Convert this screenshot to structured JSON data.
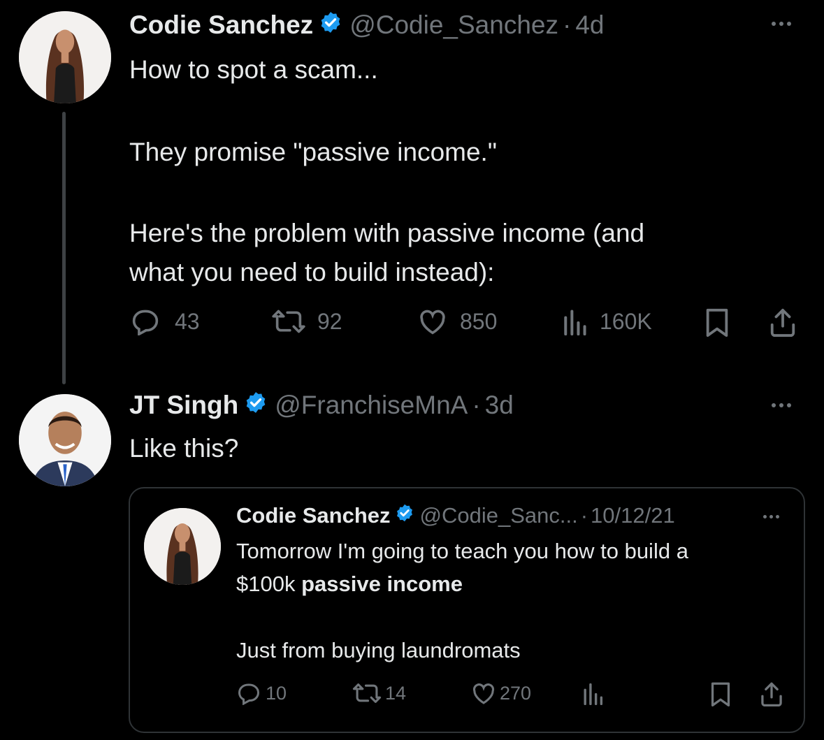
{
  "tweet1": {
    "name": "Codie Sanchez",
    "handle": "@Codie_Sanchez",
    "dot": "·",
    "time": "4d",
    "lines": [
      "How to spot a scam...",
      "They promise \"passive income.\"",
      "Here's the problem with passive income (and",
      "what you need to build instead):"
    ],
    "replies": "43",
    "retweets": "92",
    "likes": "850",
    "views": "160K"
  },
  "tweet2": {
    "name": "JT Singh",
    "handle": "@FranchiseMnA",
    "dot": "·",
    "time": "3d",
    "text": "Like this?"
  },
  "quote": {
    "name": "Codie Sanchez",
    "handle": "@Codie_Sanc...",
    "dot": "·",
    "time": "10/12/21",
    "line1": "Tomorrow I'm going to teach you how to build a",
    "line2_plain": "$100k ",
    "line2_bold": "passive income",
    "line3": "Just from buying laundromats",
    "replies": "10",
    "retweets": "14",
    "likes": "270"
  },
  "colors": {
    "verified": "#1d9bf0",
    "muted": "#71767b",
    "text": "#e7e9ea",
    "background": "#000000",
    "border": "#2f3336"
  },
  "icons": [
    "reply-icon",
    "retweet-icon",
    "like-icon",
    "views-icon",
    "bookmark-icon",
    "share-icon",
    "verified-badge-icon",
    "more-icon"
  ]
}
